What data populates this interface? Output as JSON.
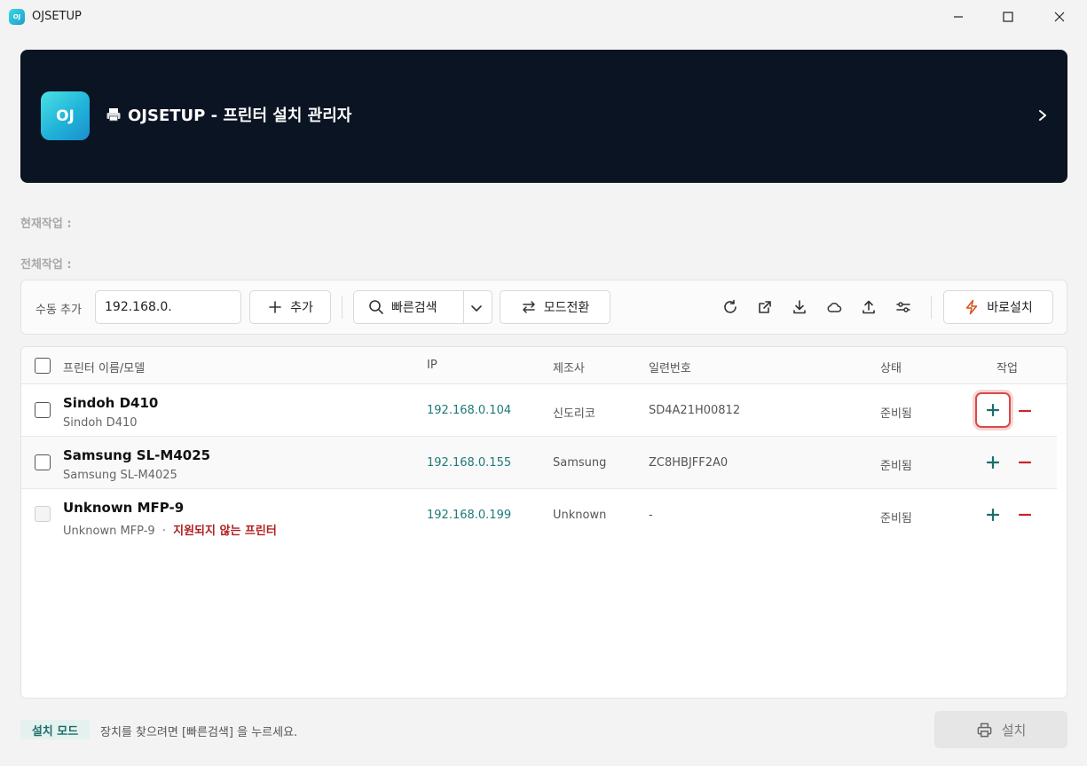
{
  "window": {
    "title": "OJSETUP",
    "icon_text": "OJ"
  },
  "banner": {
    "logo_text": "OJ",
    "title": "OJSETUP - 프린터 설치 관리자",
    "title_icon": "printer-icon"
  },
  "status": {
    "current_task_label": "현재작업 :",
    "total_task_label": "전체작업 :"
  },
  "toolbar": {
    "manual_add_label": "수동 추가",
    "ip_input_value": "192.168.0.",
    "add_label": "추가",
    "quick_search_label": "빠른검색",
    "mode_switch_label": "모드전환",
    "quick_install_label": "바로설치",
    "icons": [
      "refresh-icon",
      "external-link-icon",
      "download-icon",
      "cloud-icon",
      "upload-icon",
      "settings-sliders-icon"
    ]
  },
  "table": {
    "headers": {
      "name": "프린터 이름/모델",
      "ip": "IP",
      "maker": "제조사",
      "serial": "일련번호",
      "status": "상태",
      "action": "작업"
    },
    "rows": [
      {
        "name": "Sindoh D410",
        "model": "Sindoh D410",
        "ip": "192.168.0.104",
        "maker": "신도리코",
        "serial": "SD4A21H00812",
        "status": "준비됨",
        "warning": ""
      },
      {
        "name": "Samsung SL-M4025",
        "model": "Samsung SL-M4025",
        "ip": "192.168.0.155",
        "maker": "Samsung",
        "serial": "ZC8HBJFF2A0",
        "status": "준비됨",
        "warning": ""
      },
      {
        "name": "Unknown MFP-9",
        "model": "Unknown MFP-9",
        "separator": "·",
        "ip": "192.168.0.199",
        "maker": "Unknown",
        "serial": "-",
        "status": "준비됨",
        "warning": "지원되지 않는 프린터"
      }
    ]
  },
  "footer": {
    "mode_badge": "설치 모드",
    "message": "장치를 찾으려면 [빠른검색] 을 누르세요.",
    "install_label": "설치"
  },
  "colors": {
    "banner_bg": "#0b1422",
    "ip_text": "#1d7a76",
    "add_icon": "#1d6e6a",
    "remove_icon": "#c62828",
    "warning_text": "#b01e1e",
    "highlight_border": "#d9494b"
  }
}
